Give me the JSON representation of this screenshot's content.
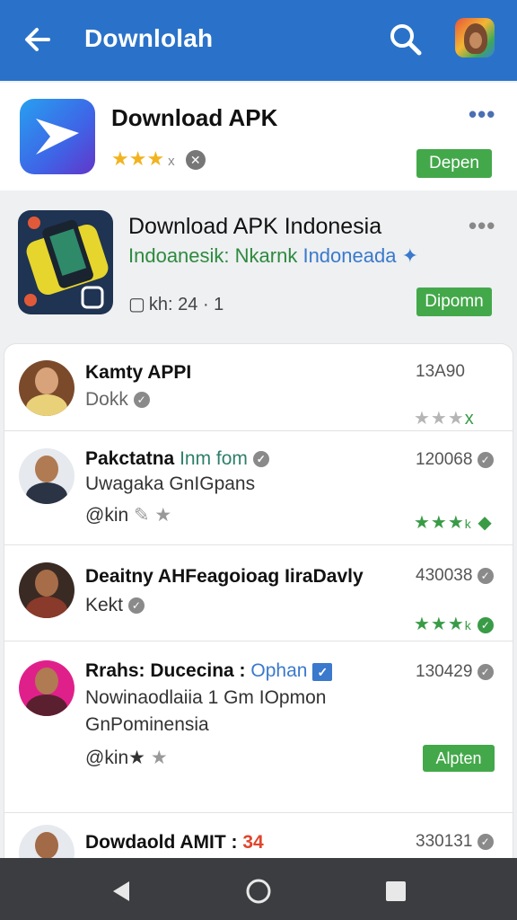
{
  "header": {
    "title": "Downlolah",
    "back_icon": "arrow-left-icon",
    "search_icon": "search-icon",
    "avatar_icon": "profile-avatar"
  },
  "featured": {
    "name": "Download APK",
    "rating_text": "★★★",
    "button": "Depen"
  },
  "promo": {
    "name": "Download APK Indonesia",
    "sub_green": "Indoanesik: Nkarnk",
    "sub_blue": "Indoneada",
    "meta": "kh: 24 · 1",
    "button": "Dipomn"
  },
  "items": [
    {
      "name": "Kamty APPI",
      "line2": "Dokk",
      "count": "13A90",
      "stars": "★★★",
      "suffix": "x"
    },
    {
      "name": "Pakctatna",
      "name_b": "Inm fom",
      "line2": "Uwagaka GnIGpans",
      "line3": "@kin",
      "count": "120068",
      "stars": "★★★",
      "suffix": "k"
    },
    {
      "name": "Deaitny AHFeagoioag IiraDavly",
      "line2": "Kekt",
      "count": "430038",
      "stars": "★★★",
      "suffix": "k"
    },
    {
      "name": "Rrahs: Ducecina :",
      "name_b": "Ophan",
      "line2": "Nowinaodlaiia 1 Gm IOpmon",
      "line3_a": "GnPominensia",
      "line3_b": "@kin",
      "count": "130429",
      "button": "Alpten"
    },
    {
      "name": "Dowdaold AMIT :",
      "name_b": "34",
      "count": "330131"
    }
  ],
  "colors": {
    "header": "#2a72c9",
    "accent_green": "#43a84a",
    "navbar": "#3b3d40"
  }
}
